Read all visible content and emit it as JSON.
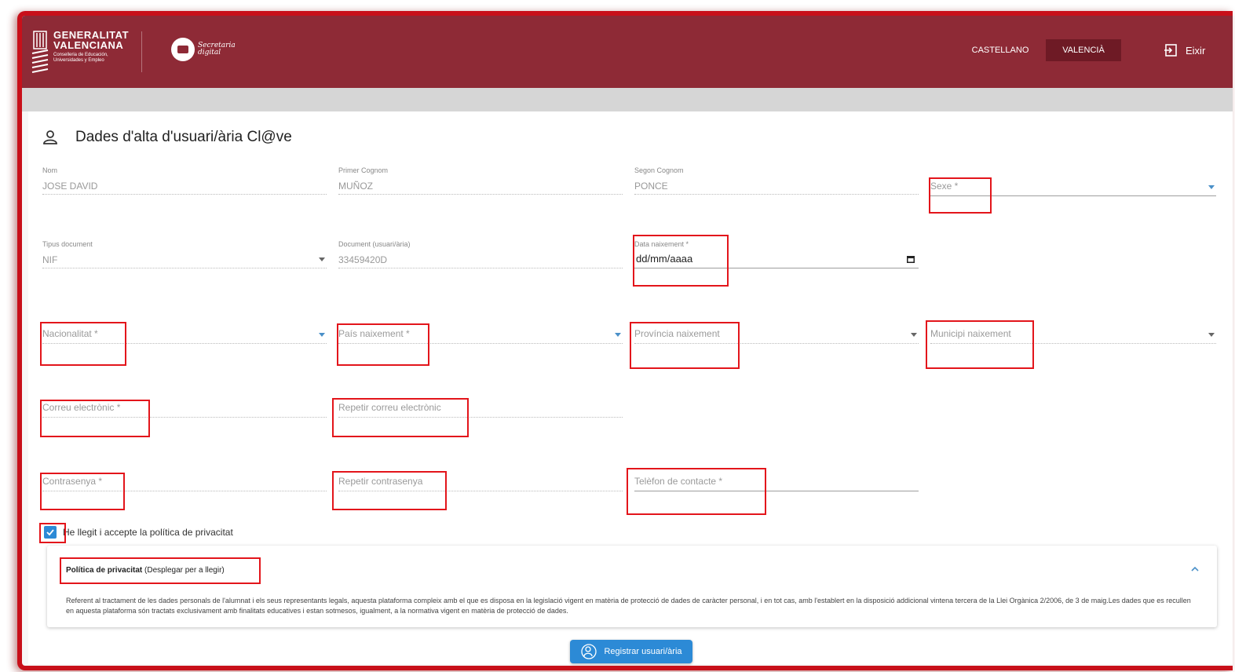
{
  "header": {
    "org_line1": "GENERALITAT",
    "org_line2": "VALENCIANA",
    "org_sub": "Conselleria de Educación, Universidades y Empleo",
    "secretaria_line1": "Secretaria",
    "secretaria_line2": "digital",
    "lang_castellano": "CASTELLANO",
    "lang_valencia": "VALENCIÀ",
    "exit_label": "Eixir",
    "bar_color": "#8e2a36"
  },
  "form": {
    "title": "Dades d'alta d'usuari/ària Cl@ve",
    "nom": {
      "label": "Nom",
      "value": "JOSE DAVID"
    },
    "primer_cognom": {
      "label": "Primer Cognom",
      "value": "MUÑOZ"
    },
    "segon_cognom": {
      "label": "Segon Cognom",
      "value": "PONCE"
    },
    "sexe": {
      "placeholder": "Sexe *"
    },
    "tipus_document": {
      "label": "Tipus document",
      "value": "NIF"
    },
    "document": {
      "label": "Document (usuari/ària)",
      "value": "33459420D"
    },
    "data_naixement": {
      "label": "Data naixement *",
      "value": "dd/mm/aaaa"
    },
    "nacionalitat": {
      "placeholder": "Nacionalitat *"
    },
    "pais_naixement": {
      "placeholder": "País naixement *"
    },
    "provincia_naixement": {
      "placeholder": "Província naixement"
    },
    "municipi_naixement": {
      "placeholder": "Municipi naixement"
    },
    "correu": {
      "placeholder": "Correu electrònic *"
    },
    "repetir_correu": {
      "placeholder": "Repetir correu electrònic"
    },
    "contrasenya": {
      "placeholder": "Contrasenya *"
    },
    "repetir_contrasenya": {
      "placeholder": "Repetir contrasenya"
    },
    "telefon": {
      "placeholder": "Telèfon de contacte *"
    },
    "privacy_checkbox_label": "He llegit i accepte la política de privacitat",
    "privacy_checked": true
  },
  "policy": {
    "heading_bold": "Política de privacitat",
    "heading_rest": " (Desplegar per a llegir)",
    "body": "Referent al tractament de les dades personals de l'alumnat i els seus representants legals, aquesta plataforma compleix amb el que es disposa en la legislació vigent en matèria de protecció de dades de caràcter personal, i en tot cas, amb l'establert en la disposició addicional vintena tercera de la Llei Orgànica 2/2006, de 3 de maig.Les dades que es recullen en aquesta plataforma són tractats exclusivament amb finalitats educatives i estan sotmesos, igualment, a la normativa vigent en matèria de protecció de dades."
  },
  "actions": {
    "register_label": "Registrar usuari/ària"
  },
  "colors": {
    "accent": "#2c8ad6",
    "highlight": "#e3151b"
  }
}
